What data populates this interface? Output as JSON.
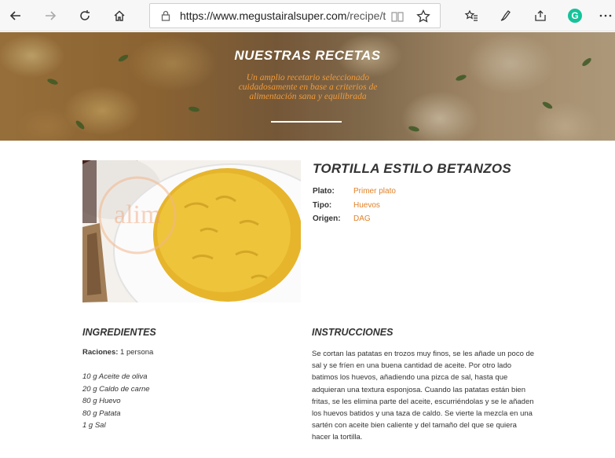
{
  "browser": {
    "url_host": "https://www.megustairalsuper.com",
    "url_path": "/recipe/tor",
    "buttons": [
      "back",
      "forward",
      "refresh",
      "home",
      "favorites",
      "notes",
      "share",
      "profile",
      "more"
    ],
    "profile_letter": "G"
  },
  "hero": {
    "title": "NUESTRAS RECETAS",
    "subtitle": "Un amplio recetario seleccionado cuidadosamente en base a criterios de alimentación sana y equilibrada"
  },
  "photo": {
    "watermark": "alim"
  },
  "recipe": {
    "title": "TORTILLA ESTILO BETANZOS",
    "meta": [
      {
        "label": "Plato:",
        "value": "Primer plato"
      },
      {
        "label": "Tipo:",
        "value": "Huevos"
      },
      {
        "label": "Origen:",
        "value": "DAG"
      }
    ]
  },
  "ingredients": {
    "heading": "INGREDIENTES",
    "portions_label": "Raciones:",
    "portions_value": "1 persona",
    "items": [
      "10 g Aceite de oliva",
      "20 g Caldo de carne",
      "80 g Huevo",
      "80 g Patata",
      "1 g Sal"
    ]
  },
  "instructions": {
    "heading": "INSTRUCCIONES",
    "text": "Se cortan las patatas en trozos muy finos, se les añade un poco de sal y se fríen en una buena cantidad de aceite. Por otro lado batimos los huevos, añadiendo una pizca de sal, hasta que adquieran una textura esponjosa. Cuando las patatas están bien fritas, se les elimina parte del aceite, escurriéndolas y se le añaden los huevos batidos y una taza de caldo. Se vierte la mezcla en una sartén con aceite bien caliente y del tamaño del que se quiera hacer la tortilla."
  },
  "colors": {
    "accent": "#e0822a",
    "hero_subtitle": "#f29b3a",
    "text": "#333333"
  }
}
